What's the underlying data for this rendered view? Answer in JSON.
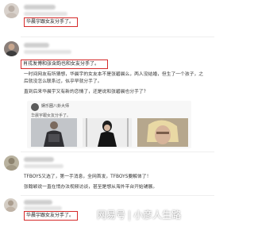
{
  "comments": [
    {
      "highlighted_text": "华晨宇跟女友分手了。"
    },
    {
      "highlighted_text": "肖戎发博和张含韵也和女友分手了。",
      "paragraphs": [
        "一时间网友有所猜想，华晨宇的女友本不是张碧晨么，两人没结婚，但生了一个孩子，之",
        "后就没怎么联系过，似乎早就分手了。",
        "直到后来华晨宇又有新的恋情了，还是说和张碧晨也分手了？"
      ],
      "repost_card": {
        "author": "娱乐圈八卦大师",
        "text": "华晨宇跟女友分手了。"
      }
    },
    {
      "paragraphs": [
        "TFBOYS又选了，第一手消息，全网首发，TFBOYS要解体了！",
        "张翰颖说一直在悄办法视频访谈，甚至是想从海外平台开始铺展。"
      ]
    },
    {
      "highlighted_text": "华晨宇跟女友分手了。"
    }
  ],
  "watermark": {
    "platform": "网易号",
    "separator": "|",
    "account": "小彦人生路"
  },
  "colors": {
    "highlight_border": "#d52a2a",
    "watermark_text": "#ffffff"
  }
}
